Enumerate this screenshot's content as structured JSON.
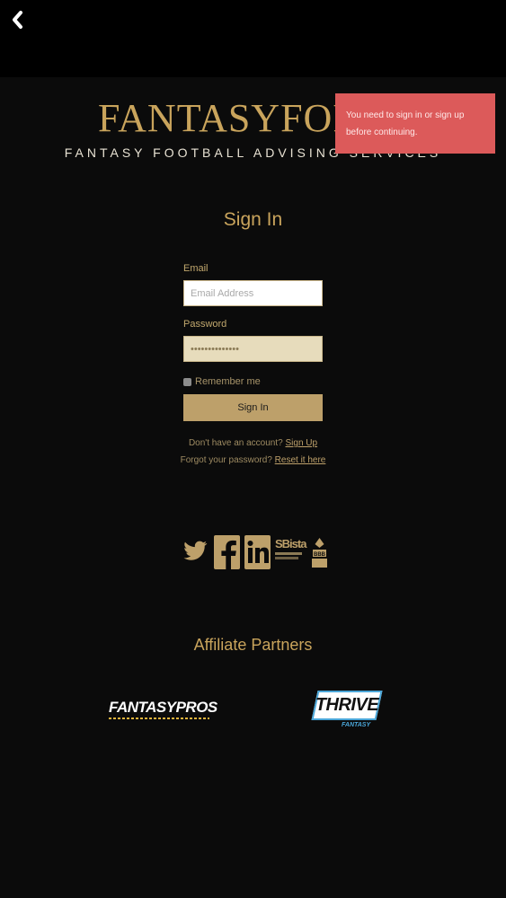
{
  "header": {
    "back_icon": "chevron-left-icon"
  },
  "logo": {
    "main": "FANTASYFORES",
    "tagline": "FANTASY FOOTBALL ADVISING SERVICES"
  },
  "toast": {
    "message": "You need to sign in or sign up before continuing."
  },
  "signin": {
    "title": "Sign In",
    "email_label": "Email",
    "email_placeholder": "Email Address",
    "password_label": "Password",
    "password_value": "••••••••••••••",
    "remember_label": "Remember me",
    "button_label": "Sign In",
    "no_account_text": "Don't have an account?",
    "signup_link": "Sign Up",
    "forgot_text": "Forgot your password?",
    "reset_link": "Reset it here"
  },
  "social": {
    "icons": [
      "twitter-icon",
      "facebook-icon",
      "linkedin-icon",
      "sbista-logo",
      "bbb-logo"
    ],
    "sbista_text": "SBista"
  },
  "affiliates": {
    "title": "Affiliate Partners",
    "fantasypros": {
      "part1": "FANTASY",
      "part2": "PROS"
    },
    "thrive": {
      "name": "THRIVE",
      "sub": "FANTASY"
    }
  },
  "colors": {
    "gold": "#c9a45c",
    "toast": "#dc5a5a",
    "background": "#0b0b0b"
  }
}
